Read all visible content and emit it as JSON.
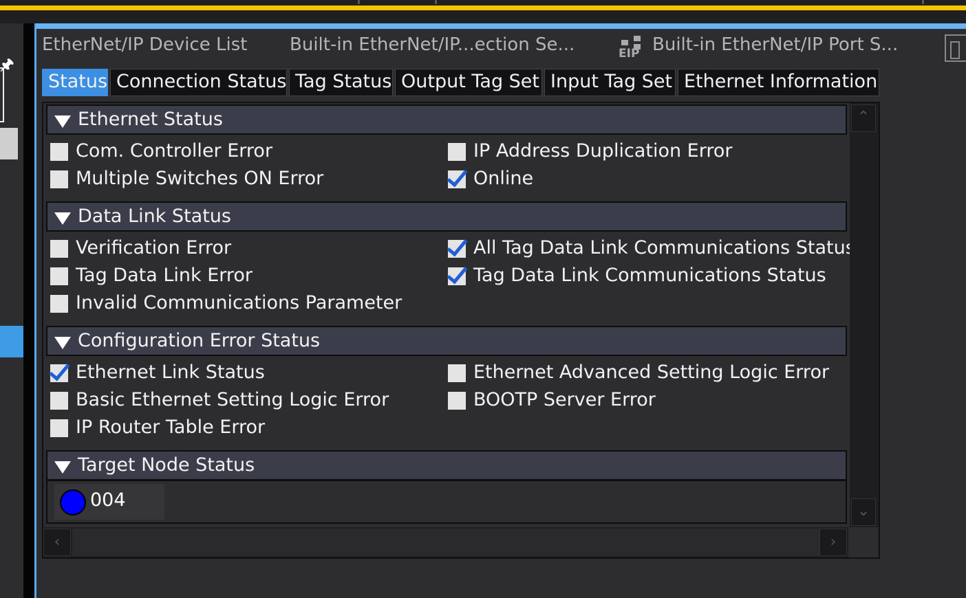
{
  "document_tabs": [
    {
      "label": "EtherNet/IP Device List"
    },
    {
      "label": "Built-in EtherNet/IP...ection Se..."
    },
    {
      "label": "Built-in EtherNet/IP Port S..."
    }
  ],
  "eip_icon_text": "EIP",
  "sub_tabs": [
    {
      "label": "Status",
      "active": true
    },
    {
      "label": "Connection Status"
    },
    {
      "label": "Tag Status"
    },
    {
      "label": "Output Tag Set"
    },
    {
      "label": "Input Tag Set"
    },
    {
      "label": "Ethernet Information"
    }
  ],
  "sections": {
    "ethernet_status": {
      "title": "Ethernet Status",
      "items": [
        {
          "label": "Com. Controller Error",
          "checked": false
        },
        {
          "label": "IP Address Duplication Error",
          "checked": false
        },
        {
          "label": "Multiple Switches ON Error",
          "checked": false
        },
        {
          "label": "Online",
          "checked": true
        }
      ]
    },
    "data_link_status": {
      "title": "Data Link Status",
      "items": [
        {
          "label": "Verification Error",
          "checked": false
        },
        {
          "label": "All Tag Data Link Communications Status",
          "checked": true
        },
        {
          "label": "Tag Data Link Error",
          "checked": false
        },
        {
          "label": "Tag Data Link Communications Status",
          "checked": true
        },
        {
          "label": "Invalid Communications Parameter",
          "checked": false
        }
      ]
    },
    "configuration_error_status": {
      "title": "Configuration Error Status",
      "items": [
        {
          "label": "Ethernet Link Status",
          "checked": true
        },
        {
          "label": "Ethernet Advanced Setting Logic Error",
          "checked": false
        },
        {
          "label": "Basic Ethernet Setting Logic Error",
          "checked": false
        },
        {
          "label": "BOOTP Server Error",
          "checked": false
        },
        {
          "label": "IP Router Table Error",
          "checked": false
        }
      ]
    },
    "target_node_status": {
      "title": "Target Node Status",
      "nodes": [
        {
          "number": "004",
          "status_color": "#0000ff"
        }
      ]
    }
  },
  "colors": {
    "accent": "#3c8fe3",
    "checkmark": "#1f5fd6",
    "title_bar": "#f5c400"
  }
}
